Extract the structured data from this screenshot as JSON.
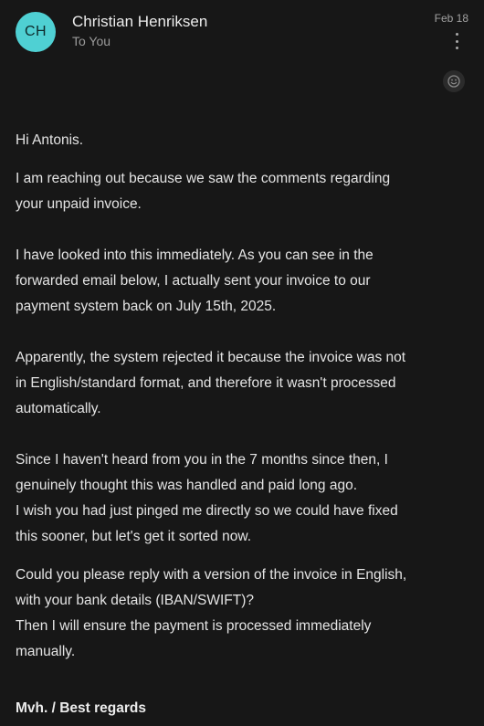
{
  "sender": {
    "initials": "CH",
    "name": "Christian Henriksen",
    "recipient_line": "To You",
    "avatar_color": "#4fd0d3"
  },
  "meta": {
    "date": "Feb 18"
  },
  "icons": {
    "more": "more-vertical-icon",
    "emoji": "emoji-smiley-icon"
  },
  "message": {
    "greeting": "Hi Antonis.",
    "paragraphs": [
      "I am reaching out because we saw the comments regarding\nyour unpaid invoice.",
      "I have looked into this immediately. As you can see in the\nforwarded email below, I actually sent your invoice to our\npayment system back on July 15th, 2025.",
      "Apparently, the system rejected it because the invoice was not\nin English/standard format, and therefore it wasn't processed\nautomatically.",
      "Since I haven't heard from you in the 7 months since then, I\ngenuinely thought this was handled and paid long ago.\nI wish you had just pinged me directly so we could have fixed\nthis sooner, but let's get it sorted now.",
      "Could you please reply with a version of the invoice in English,\nwith your bank details (IBAN/SWIFT)?\nThen I will ensure the payment is processed immediately\nmanually."
    ],
    "signoff": "Mvh. / Best regards"
  }
}
